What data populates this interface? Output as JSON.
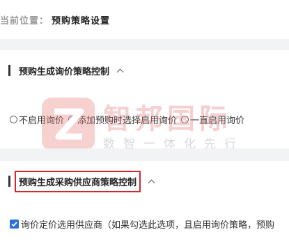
{
  "breadcrumb": {
    "prefix": "当前位置：",
    "title": "预购策略设置"
  },
  "section1": {
    "title": "预购生成询价策略控制",
    "options": [
      {
        "label": "不启用询价",
        "checked": false
      },
      {
        "label": "添加预购时选择启用询价",
        "checked": true
      },
      {
        "label": "一直启用询价",
        "checked": false
      }
    ]
  },
  "section2": {
    "title": "预购生成采购供应商策略控制",
    "highlight_color": "#d6262b",
    "checkbox_label": "询价定价选用供应商（如果勾选此选项，且启用询价策略，预购",
    "checkbox_checked": true
  },
  "watermark": {
    "brand": "智邦国际",
    "slogan": "数智一体化先行者",
    "logo_color": "#e87878"
  }
}
